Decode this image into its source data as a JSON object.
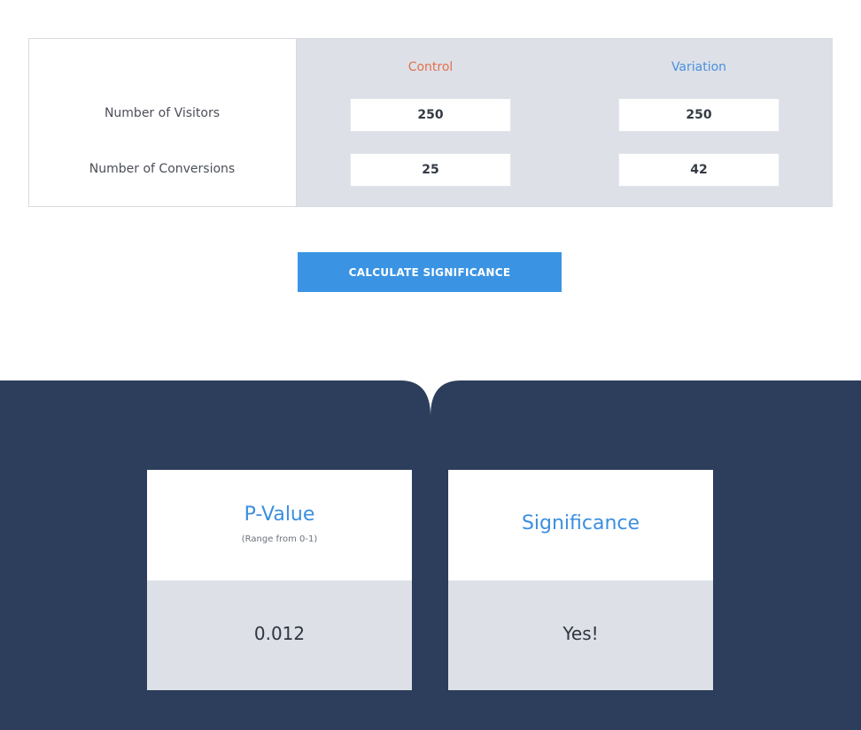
{
  "table": {
    "columns": {
      "control": "Control",
      "variation": "Variation"
    },
    "rows": {
      "visitors_label": "Number of Visitors",
      "conversions_label": "Number of Conversions"
    },
    "values": {
      "control_visitors": "250",
      "variation_visitors": "250",
      "control_conversions": "25",
      "variation_conversions": "42"
    }
  },
  "button": {
    "label": "CALCULATE SIGNIFICANCE"
  },
  "results": {
    "pvalue": {
      "title": "P-Value",
      "subtitle": "(Range from 0-1)",
      "value": "0.012"
    },
    "significance": {
      "title": "Significance",
      "value": "Yes!"
    }
  },
  "colors": {
    "control": "#e2704e",
    "variation": "#4a8fe0",
    "button": "#3b94e3",
    "panel": "#2c3e5c"
  }
}
